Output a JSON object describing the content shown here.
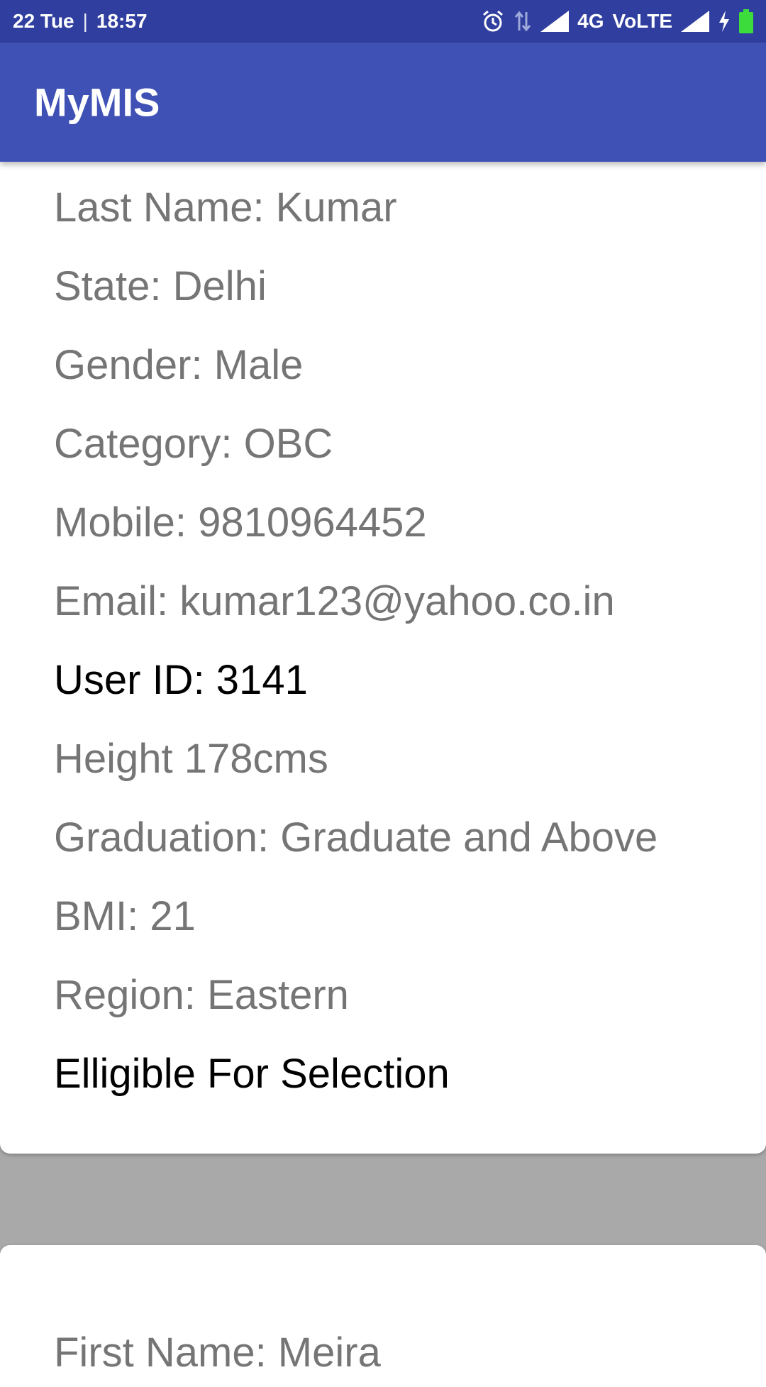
{
  "status_bar": {
    "date": "22 Tue",
    "separator": "|",
    "time": "18:57",
    "network": "4G",
    "volte": "VoLTE"
  },
  "app_bar": {
    "title": "MyMIS"
  },
  "records": [
    {
      "fields": [
        "Last Name: Kumar",
        "State: Delhi",
        "Gender: Male",
        "Category: OBC",
        "Mobile: 9810964452",
        "Email: kumar123@yahoo.co.in",
        "User ID: 3141",
        "Height 178cms",
        "Graduation: Graduate and Above",
        "BMI: 21",
        "Region: Eastern",
        "Elligible For Selection"
      ]
    },
    {
      "fields": [
        "First Name: Meira"
      ]
    }
  ],
  "colors": {
    "status_bar": "#303f9f",
    "app_bar": "#3f51b5",
    "secondary_text": "#757575",
    "primary_text": "#000000",
    "background": "#a9a9a9",
    "battery": "#3ddc3d"
  }
}
